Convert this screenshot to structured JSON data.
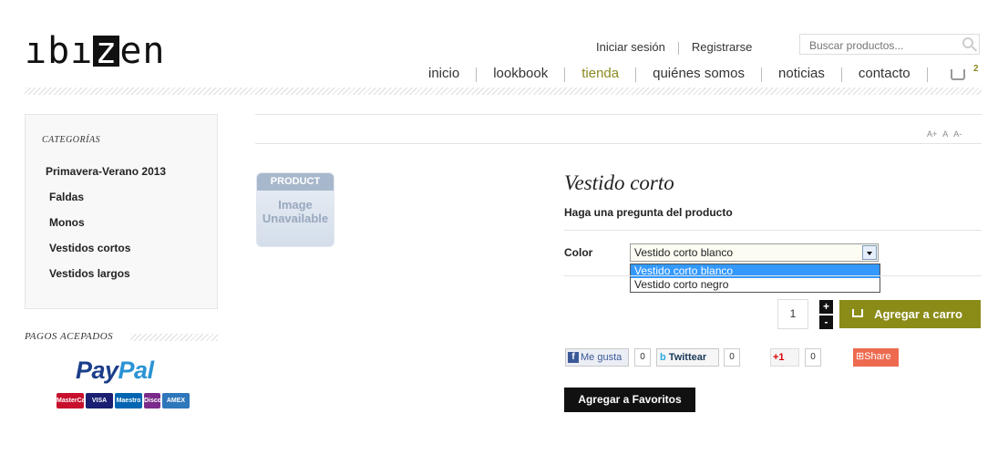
{
  "brand": {
    "logo_part1": "ıbı",
    "logo_z": "z",
    "logo_part2": "en"
  },
  "header": {
    "login": "Iniciar sesión",
    "register": "Registrarse",
    "search_placeholder": "Buscar productos...",
    "nav": [
      "inicio",
      "lookbook",
      "tienda",
      "quiénes somos",
      "noticias",
      "contacto"
    ],
    "active_nav": "tienda",
    "cart_count": "2"
  },
  "sidebar": {
    "categories_title": "CATEGORÍAS",
    "categories": [
      "Primavera-Verano 2013",
      "Faldas",
      "Monos",
      "Vestidos cortos",
      "Vestidos largos"
    ],
    "payments_title": "PAGOS ACEPADOS",
    "paypal_part1": "Pay",
    "paypal_part2": "Pal",
    "cards": [
      "MasterCard",
      "VISA",
      "Maestro",
      "Discover",
      "AMEX"
    ]
  },
  "fontsize": {
    "increase": "A+",
    "reset": "A",
    "decrease": "A-"
  },
  "product": {
    "image_header": "PRODUCT",
    "image_line1": "Image",
    "image_line2": "Unavailable",
    "title": "Vestido corto",
    "ask_question": "Haga una pregunta del producto",
    "color_label": "Color",
    "color_selected": "Vestido corto blanco",
    "color_options": [
      "Vestido corto blanco",
      "Vestido corto negro"
    ],
    "quantity": "1",
    "plus": "+",
    "minus": "-",
    "add_to_cart": "Agregar a carro",
    "add_to_favorites": "Agregar a Favoritos"
  },
  "social": {
    "fb_icon": "f",
    "fb_label": "Me gusta",
    "fb_count": "0",
    "tw_icon": "b",
    "tw_label": "Twittear",
    "tw_count": "0",
    "gp_label": "+1",
    "gp_count": "0",
    "share_label": "Share"
  }
}
